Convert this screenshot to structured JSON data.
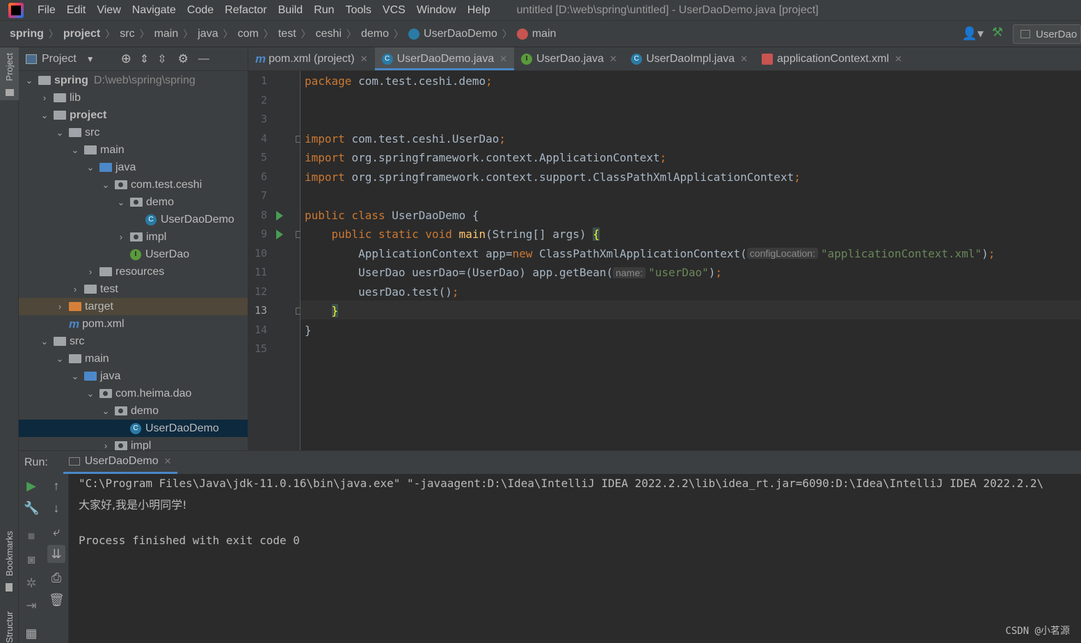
{
  "menubar": {
    "items": [
      "File",
      "Edit",
      "View",
      "Navigate",
      "Code",
      "Refactor",
      "Build",
      "Run",
      "Tools",
      "VCS",
      "Window",
      "Help"
    ],
    "title": "untitled [D:\\web\\spring\\untitled] - UserDaoDemo.java [project]"
  },
  "breadcrumb": [
    "spring",
    "project",
    "src",
    "main",
    "java",
    "com",
    "test",
    "ceshi",
    "demo",
    "UserDaoDemo",
    "main"
  ],
  "run_config": "UserDao",
  "left_strip": {
    "project": "Project",
    "bookmarks": "Bookmarks",
    "structure": "Structure"
  },
  "project_panel": {
    "title": "Project",
    "tree": [
      {
        "label": "spring",
        "path": "D:\\web\\spring\\spring",
        "depth": 0,
        "arrow": "down",
        "icon": "module",
        "bold": true
      },
      {
        "label": "lib",
        "depth": 1,
        "arrow": "right",
        "icon": "folder"
      },
      {
        "label": "project",
        "depth": 1,
        "arrow": "down",
        "icon": "module",
        "bold": true
      },
      {
        "label": "src",
        "depth": 2,
        "arrow": "down",
        "icon": "folder"
      },
      {
        "label": "main",
        "depth": 3,
        "arrow": "down",
        "icon": "folder"
      },
      {
        "label": "java",
        "depth": 4,
        "arrow": "down",
        "icon": "src-folder"
      },
      {
        "label": "com.test.ceshi",
        "depth": 5,
        "arrow": "down",
        "icon": "package"
      },
      {
        "label": "demo",
        "depth": 6,
        "arrow": "down",
        "icon": "package"
      },
      {
        "label": "UserDaoDemo",
        "depth": 7,
        "arrow": "",
        "icon": "class"
      },
      {
        "label": "impl",
        "depth": 6,
        "arrow": "right",
        "icon": "package"
      },
      {
        "label": "UserDao",
        "depth": 6,
        "arrow": "",
        "icon": "interface"
      },
      {
        "label": "resources",
        "depth": 4,
        "arrow": "right",
        "icon": "res-folder"
      },
      {
        "label": "test",
        "depth": 3,
        "arrow": "right",
        "icon": "folder"
      },
      {
        "label": "target",
        "depth": 2,
        "arrow": "right",
        "icon": "orange-folder",
        "highlight": true
      },
      {
        "label": "pom.xml",
        "depth": 2,
        "arrow": "",
        "icon": "maven"
      },
      {
        "label": "src",
        "depth": 1,
        "arrow": "down",
        "icon": "folder"
      },
      {
        "label": "main",
        "depth": 2,
        "arrow": "down",
        "icon": "folder"
      },
      {
        "label": "java",
        "depth": 3,
        "arrow": "down",
        "icon": "src-folder"
      },
      {
        "label": "com.heima.dao",
        "depth": 4,
        "arrow": "down",
        "icon": "package"
      },
      {
        "label": "demo",
        "depth": 5,
        "arrow": "down",
        "icon": "package"
      },
      {
        "label": "UserDaoDemo",
        "depth": 6,
        "arrow": "",
        "icon": "class",
        "selected": true
      },
      {
        "label": "impl",
        "depth": 5,
        "arrow": "right",
        "icon": "package"
      }
    ]
  },
  "editor_tabs": [
    {
      "label": "pom.xml (project)",
      "icon": "maven"
    },
    {
      "label": "UserDaoDemo.java",
      "icon": "class",
      "active": true
    },
    {
      "label": "UserDao.java",
      "icon": "interface"
    },
    {
      "label": "UserDaoImpl.java",
      "icon": "class"
    },
    {
      "label": "applicationContext.xml",
      "icon": "xml"
    }
  ],
  "code": {
    "line_numbers": [
      "1",
      "2",
      "3",
      "4",
      "5",
      "6",
      "7",
      "8",
      "9",
      "10",
      "11",
      "12",
      "13",
      "14",
      "15"
    ],
    "current_line": "13",
    "lines": [
      [
        [
          "kw",
          "package "
        ],
        [
          "txt",
          "com.test.ceshi.demo"
        ],
        [
          "kw",
          ";"
        ]
      ],
      [],
      [],
      [
        [
          "kw",
          "import "
        ],
        [
          "txt",
          "com.test.ceshi.UserDao"
        ],
        [
          "kw",
          ";"
        ]
      ],
      [
        [
          "kw",
          "import "
        ],
        [
          "txt",
          "org.springframework.context.ApplicationContext"
        ],
        [
          "kw",
          ";"
        ]
      ],
      [
        [
          "kw",
          "import "
        ],
        [
          "txt",
          "org.springframework.context.support.ClassPathXmlApplicationContext"
        ],
        [
          "kw",
          ";"
        ]
      ],
      [],
      [
        [
          "kw",
          "public class "
        ],
        [
          "txt",
          "UserDaoDemo {"
        ]
      ],
      [
        [
          "txt",
          "    "
        ],
        [
          "kw",
          "public static void "
        ],
        [
          "fn",
          "main"
        ],
        [
          "txt",
          "(String[] args) "
        ],
        [
          "brace",
          "{"
        ]
      ],
      [
        [
          "txt",
          "        ApplicationContext app="
        ],
        [
          "kw",
          "new "
        ],
        [
          "txt",
          "ClassPathXmlApplicationContext("
        ],
        [
          "hint",
          "configLocation:"
        ],
        [
          "str",
          "\"applicationContext.xml\""
        ],
        [
          "txt",
          ")"
        ],
        [
          "kw",
          ";"
        ]
      ],
      [
        [
          "txt",
          "        UserDao uesrDao=(UserDao) app.getBean("
        ],
        [
          "hint",
          "name:"
        ],
        [
          "str",
          "\"userDao\""
        ],
        [
          "txt",
          ")"
        ],
        [
          "kw",
          ";"
        ]
      ],
      [
        [
          "txt",
          "        uesrDao.test()"
        ],
        [
          "kw",
          ";"
        ]
      ],
      [
        [
          "txt",
          "    "
        ],
        [
          "brace",
          "}"
        ]
      ],
      [
        [
          "txt",
          "}"
        ]
      ],
      []
    ]
  },
  "run_panel": {
    "label": "Run:",
    "tab": "UserDaoDemo",
    "output": [
      "\"C:\\Program Files\\Java\\jdk-11.0.16\\bin\\java.exe\" \"-javaagent:D:\\Idea\\IntelliJ IDEA 2022.2.2\\lib\\idea_rt.jar=6090:D:\\Idea\\IntelliJ IDEA 2022.2.2\\",
      "大家好,我是小明同学!",
      "",
      "Process finished with exit code 0"
    ]
  },
  "watermark": "CSDN @小茗源"
}
